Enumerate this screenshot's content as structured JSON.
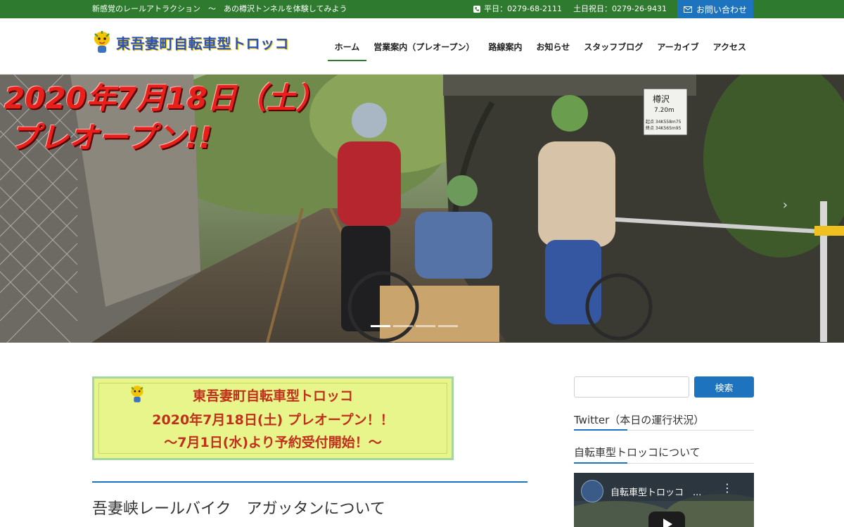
{
  "topbar": {
    "tagline": "新感覚のレールアトラクション　～　あの樽沢トンネルを体験してみよう",
    "phone_weekday": "平日：0279-68-2111",
    "phone_holiday": "土日祝日：0279-26-9431",
    "contact_label": "お問い合わせ",
    "icons": {
      "phone": "phone-icon",
      "contact": "mail-icon"
    }
  },
  "header": {
    "logo_text": "東吾妻町自転車型トロッコ",
    "nav": [
      {
        "label": "ホーム",
        "active": true
      },
      {
        "label": "営業案内（プレオープン）",
        "active": false
      },
      {
        "label": "路線案内",
        "active": false
      },
      {
        "label": "お知らせ",
        "active": false
      },
      {
        "label": "スタッフブログ",
        "active": false
      },
      {
        "label": "アーカイブ",
        "active": false
      },
      {
        "label": "アクセス",
        "active": false
      }
    ]
  },
  "hero": {
    "title_line1": "2020年7月18日（土）",
    "title_line2": "プレオープン!!",
    "sign_name": "樽沢",
    "sign_length": "7.20m",
    "sign_detail1": "起点 34K558m75",
    "sign_detail2": "終点 34K565m95",
    "slide_count": 4,
    "active_slide": 1
  },
  "banner": {
    "line1": "東吾妻町自転車型トロッコ",
    "line2": "2020年7月18日(土) プレオープン！！",
    "line3": "～7月1日(水)より予約受付開始！～"
  },
  "main": {
    "article_title": "吾妻峡レールバイク　アガッタンについて"
  },
  "sidebar": {
    "search_button": "検索",
    "search_value": "",
    "widget1_title": "Twitter（本日の運行状況）",
    "widget2_title": "自転車型トロッコについて",
    "video_title": "自転車型トロッコ　...",
    "video_menu": "⋮"
  },
  "colors": {
    "topbar": "#2e7a2e",
    "accent_blue": "#1e73be",
    "hero_title": "#e8201c",
    "banner_bg": "#e8f58a",
    "banner_text": "#c0301c"
  }
}
